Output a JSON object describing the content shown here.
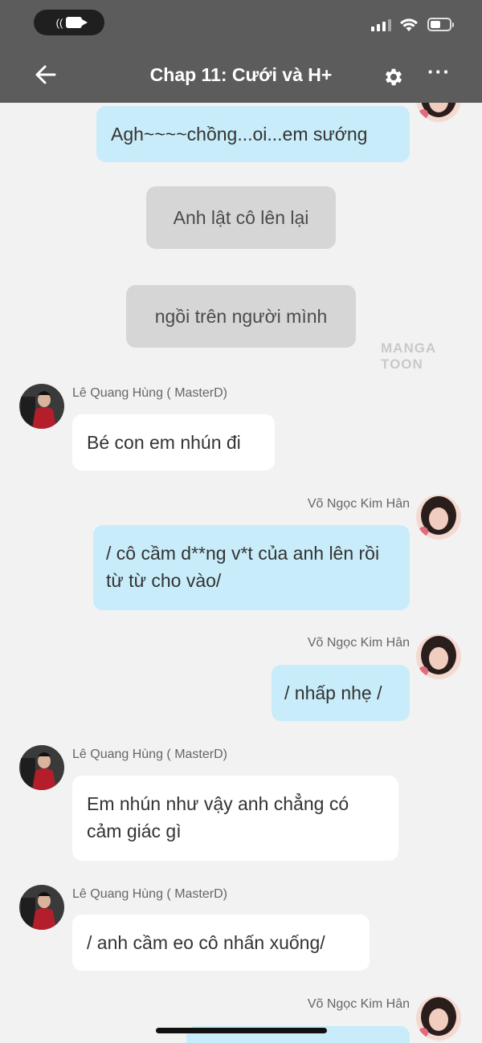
{
  "status_bar": {
    "signal_icon": "cellular-signal-icon",
    "wifi_icon": "wifi-icon",
    "battery_icon": "battery-icon",
    "battery_level": 0.55
  },
  "nav": {
    "back_icon": "back-arrow-icon",
    "title": "Chap 11: Cưới và H+",
    "settings_icon": "gear-icon",
    "more_icon": "more-icon",
    "more_glyph": "···"
  },
  "watermark": "MANGA TOON",
  "messages": [
    {
      "type": "outgoing",
      "text": "Agh~~~~chồng...oi...em sướng"
    },
    {
      "type": "narration",
      "text": "Anh lật cô lên lại"
    },
    {
      "type": "narration",
      "text": "ngồi trên người mình"
    },
    {
      "type": "incoming",
      "sender": "Lê Quang Hùng ( MasterD)",
      "text": "Bé con em nhún đi"
    },
    {
      "type": "outgoing",
      "sender": "Võ Ngọc Kim Hân",
      "text": "/ cô cầm d**ng v*t của anh lên rồi từ từ cho vào/"
    },
    {
      "type": "outgoing",
      "sender": "Võ Ngọc Kim Hân",
      "text": "/ nhấp nhẹ /"
    },
    {
      "type": "incoming",
      "sender": "Lê Quang Hùng ( MasterD)",
      "text": "Em nhún như vậy anh chẳng có cảm giác gì"
    },
    {
      "type": "incoming",
      "sender": "Lê Quang Hùng ( MasterD)",
      "text": "/ anh cầm eo cô nhấn xuống/"
    },
    {
      "type": "outgoing",
      "sender": "Võ Ngọc Kim Hân",
      "text": ""
    }
  ],
  "colors": {
    "header_bg": "#5c5c5c",
    "outgoing_bubble": "#c8ecf9",
    "incoming_bubble": "#ffffff",
    "narration_bubble": "#d6d6d6",
    "chat_bg": "#f2f2f2"
  }
}
